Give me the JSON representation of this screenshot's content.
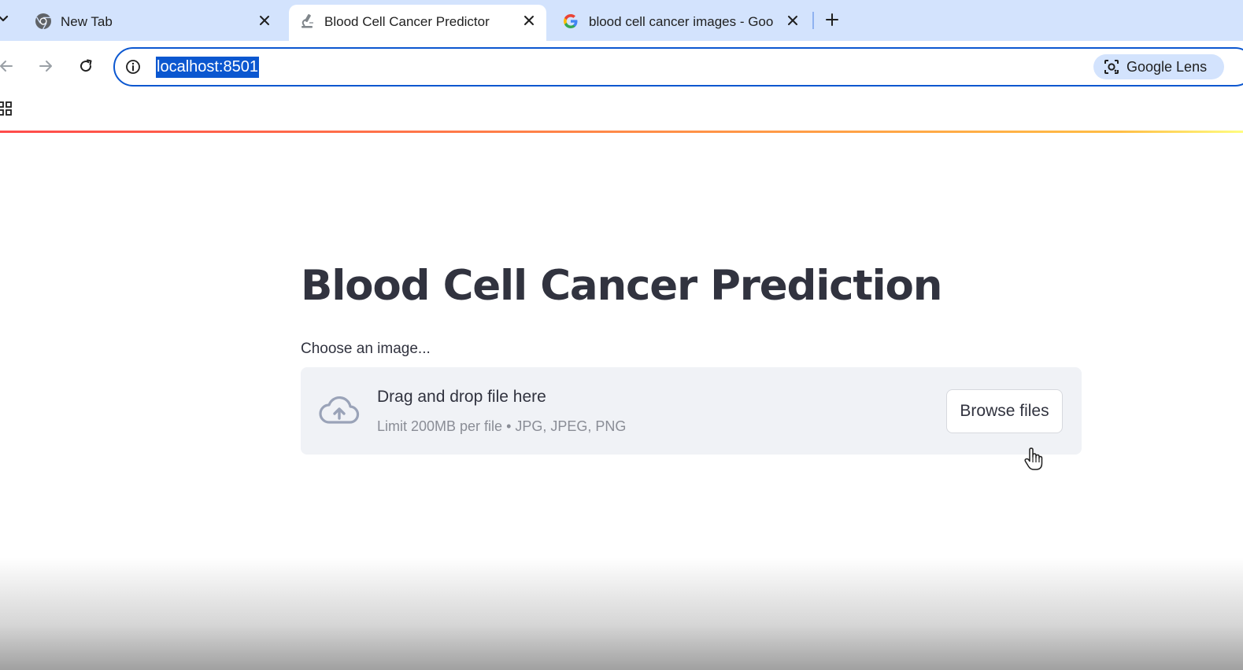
{
  "browser": {
    "tabs": [
      {
        "title": "New Tab",
        "favicon": "chrome-icon",
        "active": false
      },
      {
        "title": "Blood Cell Cancer Predictor",
        "favicon": "microscope-icon",
        "active": true
      },
      {
        "title": "blood cell cancer images - Goo",
        "favicon": "google-g-icon",
        "active": false
      }
    ],
    "address": {
      "url": "localhost:8501",
      "selected": true
    },
    "lens_label": "Google Lens"
  },
  "app": {
    "title": "Blood Cell Cancer Prediction",
    "uploader": {
      "label": "Choose an image...",
      "instructions": "Drag and drop file here",
      "limits": "Limit 200MB per file • JPG, JPEG, PNG",
      "browse_label": "Browse files"
    }
  },
  "colors": {
    "accent": "#0b57d0",
    "tabstrip": "#d3e3fd",
    "dropzone_bg": "#f0f2f6",
    "text": "#31333f",
    "decoration_start": "#ff4b4b",
    "decoration_end": "#ffbd45"
  }
}
